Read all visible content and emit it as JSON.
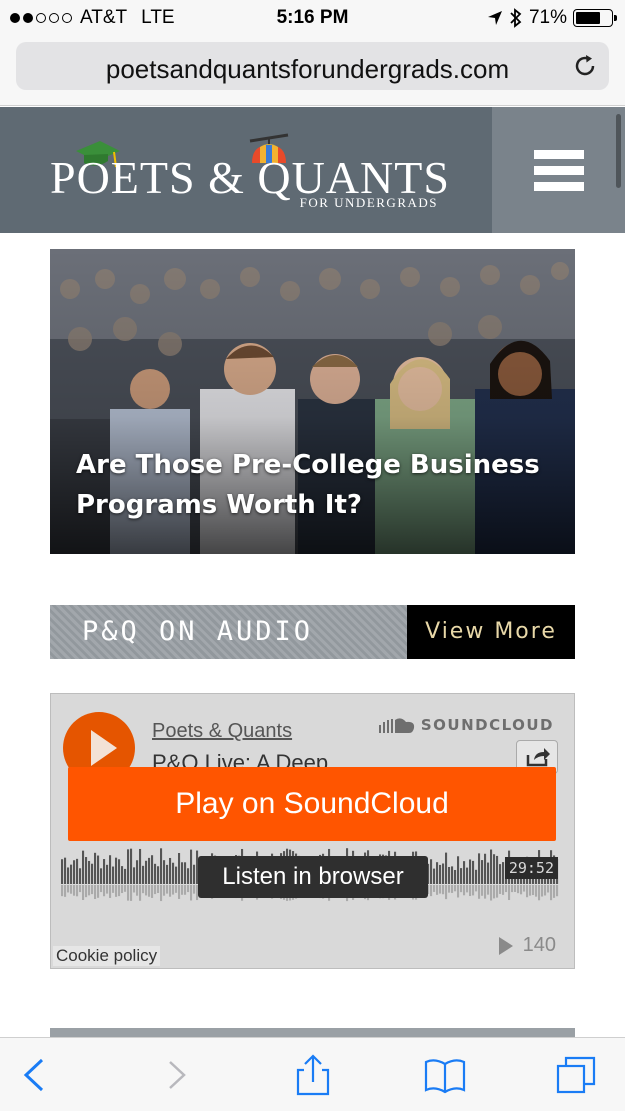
{
  "status_bar": {
    "carrier": "AT&T",
    "network": "LTE",
    "time": "5:16 PM",
    "battery": "71%",
    "battery_level": 0.71,
    "signal_bars_filled": 2,
    "signal_bars_total": 5
  },
  "browser": {
    "url": "poetsandquantsforundergrads.com",
    "reload_icon": "reload-icon"
  },
  "site_header": {
    "logo_main": "POETS & QUANTS",
    "logo_sub": "FOR UNDERGRADS",
    "menu_icon": "hamburger-menu-icon",
    "colors": {
      "background": "#5f6a73",
      "menu_background": "#7a838b"
    }
  },
  "hero": {
    "title": "Are Those Pre-College Business Programs Worth It?"
  },
  "audio_section": {
    "label": "P&Q ON AUDIO",
    "view_more": "View More"
  },
  "soundcloud": {
    "artist": "Poets & Quants",
    "track": "P&Q Live: A Deep ...",
    "brand": "SOUNDCLOUD",
    "cta": "Play on SoundCloud",
    "listen": "Listen in browser",
    "duration": "29:52",
    "plays": "140",
    "cookie": "Cookie policy",
    "colors": {
      "accent": "#ff5500"
    }
  },
  "toolbar": {
    "icons": [
      "back-icon",
      "forward-icon",
      "share-icon",
      "bookmarks-icon",
      "tabs-icon"
    ],
    "color": "#1a7cf5"
  }
}
